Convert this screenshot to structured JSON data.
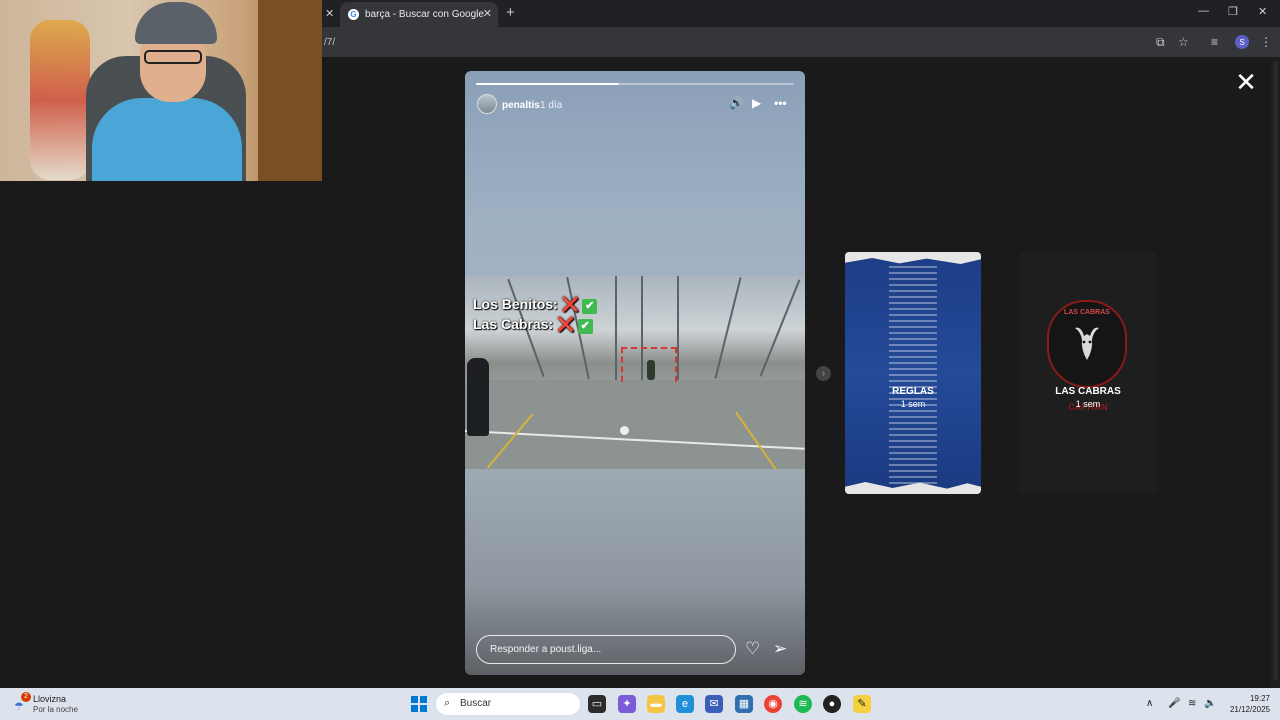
{
  "browser": {
    "tab_title": "barça - Buscar con Google",
    "tab_favicon": "G",
    "url_fragment": "/7/",
    "profile_initial": "S",
    "tab_close": "✕",
    "new_tab": "+",
    "min": "—",
    "max": "❐",
    "close": "✕"
  },
  "viewer": {
    "close_symbol": "✕",
    "next_symbol": "›"
  },
  "story": {
    "progress": 0.45,
    "username": "penaltis",
    "time": "1 día",
    "video_line1_label": "Los Benitos:",
    "video_line2_label": "Las Cabras:",
    "cross": "❌",
    "check": "✔",
    "reply_placeholder": "Responder a poust.liga...",
    "like_icon": "♡",
    "share_icon": "➢"
  },
  "previews": [
    {
      "label": "REGLAS",
      "time": "1 sem"
    },
    {
      "label": "LAS CABRAS",
      "time": "1 sem",
      "crest_top": "LAS CABRAS",
      "crest_sub": "CAPITAN"
    }
  ],
  "taskbar": {
    "weather_badge": "2",
    "weather_title": "Llovizna",
    "weather_sub": "Por la noche",
    "search_label": "Buscar",
    "time": "19:27",
    "date": "21/12/2025",
    "colors": {
      "accent": "#0078d4",
      "spotify": "#1db954",
      "chrome": "#ea4335"
    }
  }
}
